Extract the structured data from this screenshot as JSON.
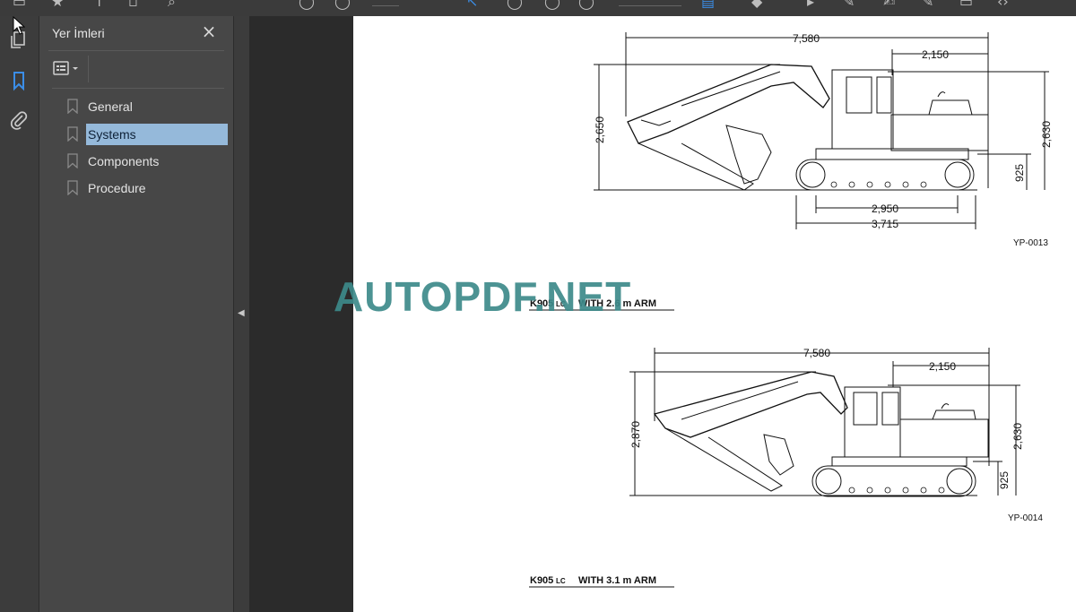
{
  "toolbar": {
    "icons": [
      "print-icon",
      "bookmark-add-icon",
      "upload-icon",
      "save-icon",
      "search-icon",
      "zoom-out-icon",
      "zoom-in-icon",
      "page-field",
      "select-tool-icon",
      "rotate-icon",
      "highlight-icon",
      "zoom-field",
      "view-icon",
      "edit-icon",
      "play-icon",
      "sign-icon",
      "fill-icon",
      "comment-icon",
      "share-icon",
      "more-icon"
    ]
  },
  "sidebar_rail": {
    "icons": [
      "pages-icon",
      "bookmarks-icon",
      "attachments-icon"
    ],
    "active": "bookmarks-icon"
  },
  "bookmarks_panel": {
    "title": "Yer İmleri",
    "items": [
      {
        "label": "General",
        "selected": false
      },
      {
        "label": "Systems",
        "selected": true
      },
      {
        "label": "Components",
        "selected": false
      },
      {
        "label": "Procedure",
        "selected": false
      }
    ]
  },
  "watermark": "AUTOPDF.NET",
  "document": {
    "figure1": {
      "dims": {
        "overall": "7,580",
        "top_right": "2,150",
        "height_left": "2,650",
        "height_right": "2,630",
        "ground": "925",
        "track_inner": "2,950",
        "track_outer": "3,715"
      },
      "ref": "YP-0013",
      "caption_parts": [
        "K905",
        "LC",
        "WITH 2.6 m ARM"
      ]
    },
    "figure2": {
      "dims": {
        "overall": "7,580",
        "top_right": "2,150",
        "height_left": "2,870",
        "height_right": "2,630",
        "ground": "925"
      },
      "ref": "YP-0014",
      "caption_parts": [
        "K905",
        "LC",
        "WITH 3.1 m ARM"
      ]
    }
  },
  "colors": {
    "accent": "#3b8ee8",
    "selection": "#95b9da",
    "watermark": "#3d8a8a"
  }
}
